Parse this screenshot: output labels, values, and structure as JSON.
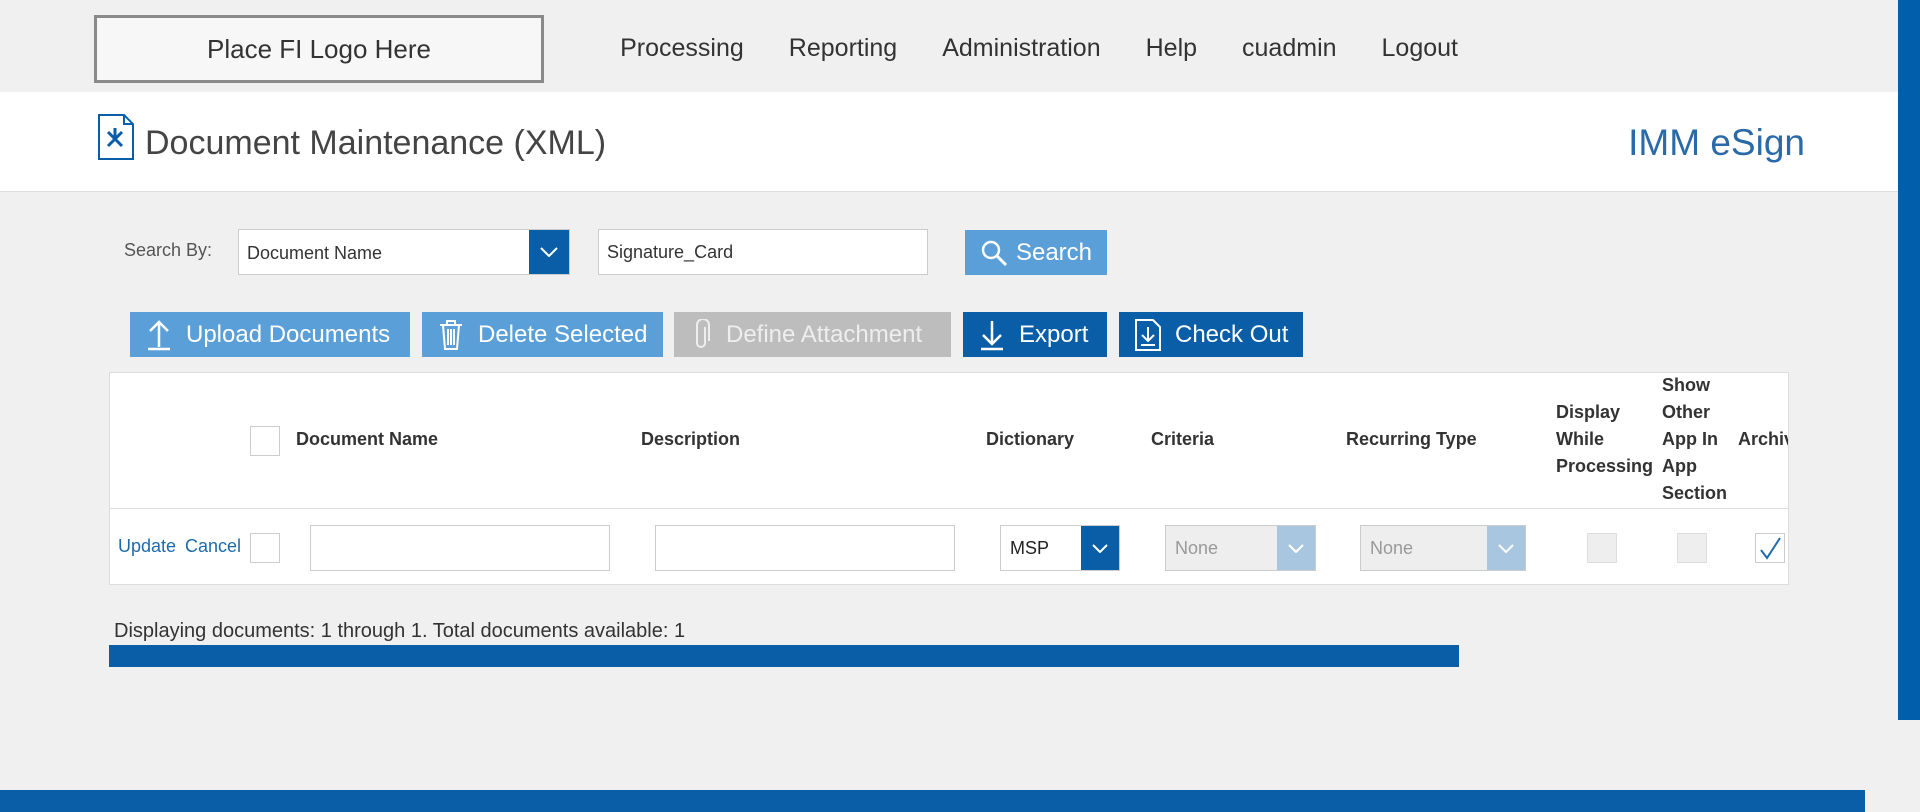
{
  "logo": {
    "text": "Place FI Logo Here"
  },
  "nav": [
    {
      "label": "Processing"
    },
    {
      "label": "Reporting"
    },
    {
      "label": "Administration"
    },
    {
      "label": "Help"
    },
    {
      "label": "cuadmin"
    },
    {
      "label": "Logout"
    }
  ],
  "header": {
    "title": "Document Maintenance (XML)",
    "brand": "IMM eSign"
  },
  "search": {
    "label": "Search By:",
    "by_value": "Document Name",
    "query": "Signature_Card",
    "button": "Search"
  },
  "toolbar": {
    "upload": "Upload Documents",
    "delete": "Delete Selected",
    "attach": "Define Attachment",
    "export": "Export",
    "checkout": "Check Out"
  },
  "table": {
    "columns": {
      "document_name": "Document Name",
      "description": "Description",
      "dictionary": "Dictionary",
      "criteria": "Criteria",
      "recurring_type": "Recurring Type",
      "display_while_processing": [
        "Display",
        "While",
        "Processing"
      ],
      "show_other_app": [
        "Show",
        "Other",
        "App In",
        "App",
        "Section"
      ],
      "archive": "Archiv"
    },
    "edit_row": {
      "update": "Update",
      "cancel": "Cancel",
      "dictionary": "MSP",
      "criteria": "None",
      "recurring_type": "None",
      "archive_checked": true
    }
  },
  "status": "Displaying documents: 1 through 1. Total documents available: 1",
  "colors": {
    "primary": "#0a5ea8",
    "light": "#5a9fd8",
    "disabled": "#bdbdbd",
    "brand": "#2a6aa8"
  }
}
